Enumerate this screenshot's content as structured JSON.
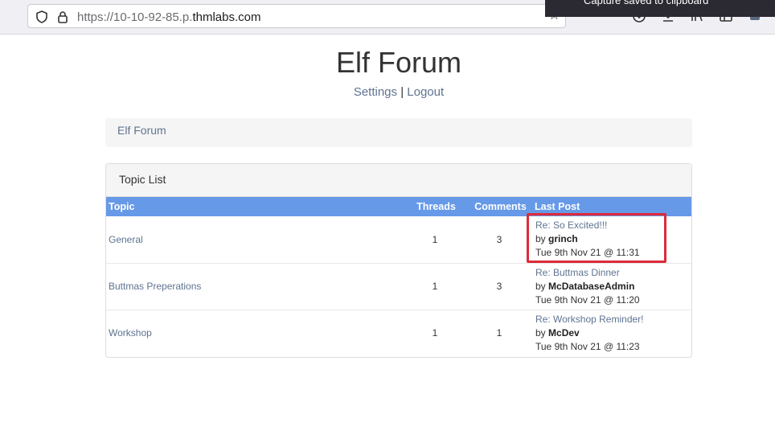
{
  "browser": {
    "url_prefix": "https://10-10-92-85.p.",
    "url_domain": "thmlabs.com",
    "toast": "Capture saved to clipboard"
  },
  "page": {
    "title": "Elf Forum",
    "nav": {
      "settings": "Settings",
      "separator": "|",
      "logout": "Logout"
    },
    "breadcrumb": "Elf Forum"
  },
  "panel": {
    "heading": "Topic List",
    "columns": {
      "topic": "Topic",
      "threads": "Threads",
      "comments": "Comments",
      "last_post": "Last Post"
    },
    "rows": [
      {
        "topic": "General",
        "threads": "1",
        "comments": "3",
        "last_title": "Re: So Excited!!!",
        "by": "by",
        "author": "grinch",
        "date": "Tue 9th Nov 21 @ 11:31"
      },
      {
        "topic": "Buttmas Preperations",
        "threads": "1",
        "comments": "3",
        "last_title": "Re: Buttmas Dinner",
        "by": "by",
        "author": "McDatabaseAdmin",
        "date": "Tue 9th Nov 21 @ 11:20"
      },
      {
        "topic": "Workshop",
        "threads": "1",
        "comments": "1",
        "last_title": "Re: Workshop Reminder!",
        "by": "by",
        "author": "McDev",
        "date": "Tue 9th Nov 21 @ 11:23"
      }
    ]
  },
  "colors": {
    "header_bg": "#6699e8",
    "link": "#5f7391",
    "highlight": "#dd2a3a"
  }
}
